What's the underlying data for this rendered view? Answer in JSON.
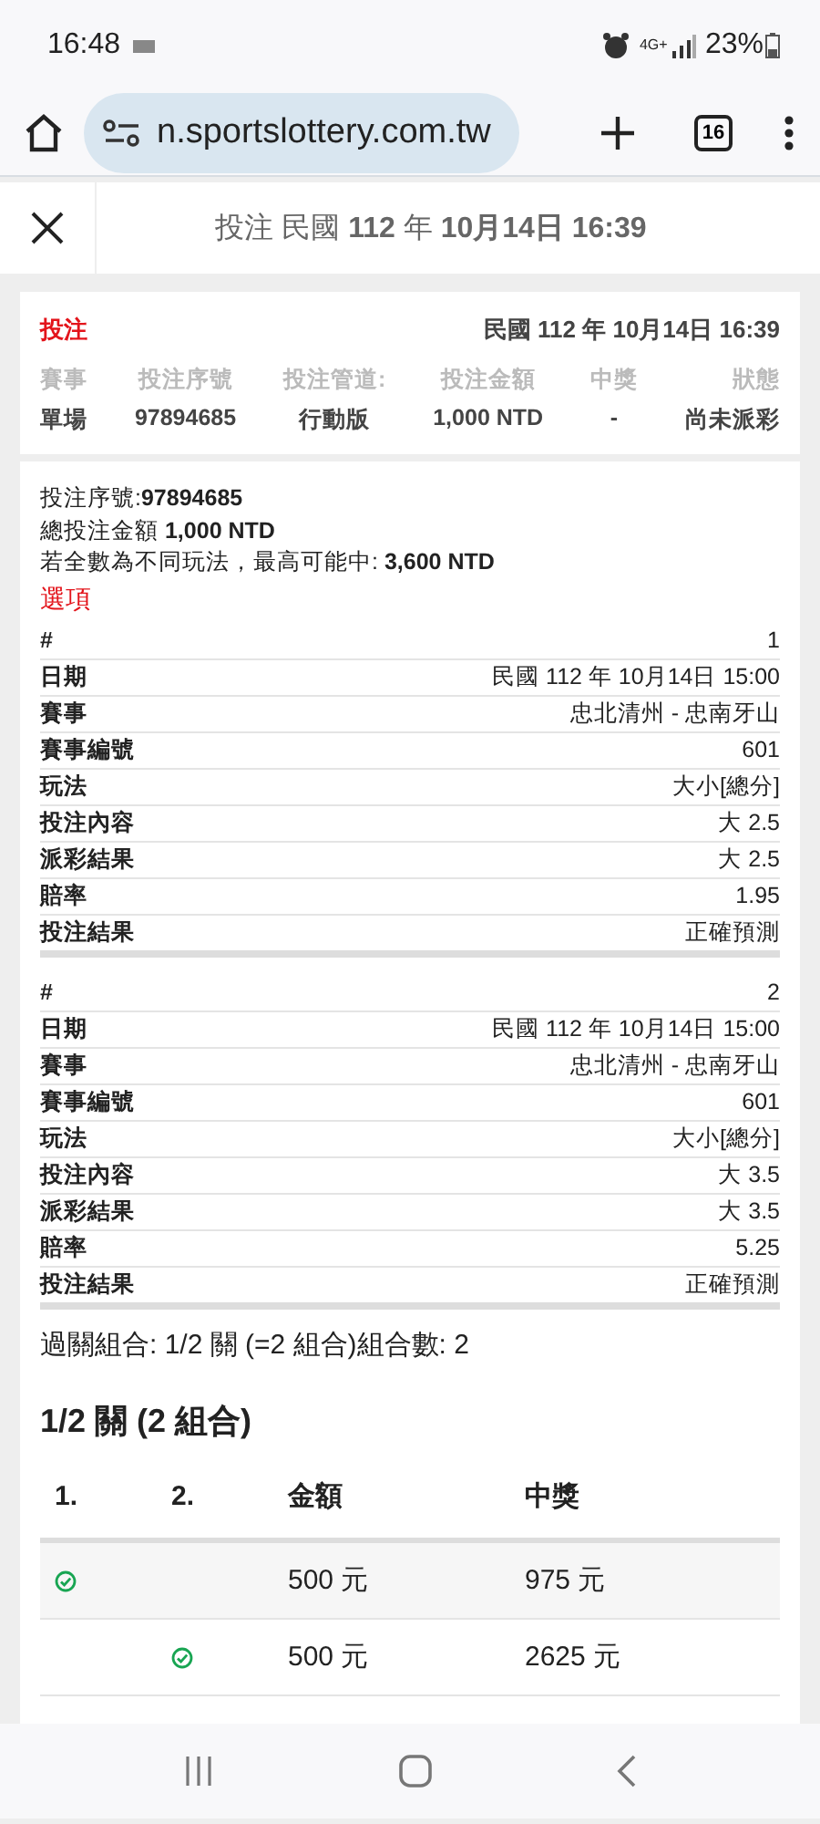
{
  "status_bar": {
    "time": "16:48",
    "network": "4G+",
    "battery": "23%"
  },
  "browser": {
    "url": "n.sportslottery.com.tw",
    "tab_count": "16"
  },
  "header": {
    "title": "投注 民國 **112** 年 **10月14日 16:39**"
  },
  "summary": {
    "type": "投注",
    "date": "民國 112 年 10月14日 16:39",
    "columns": [
      {
        "label": "賽事",
        "value": "單場"
      },
      {
        "label": "投注序號",
        "value": "97894685"
      },
      {
        "label": "投注管道:",
        "value": "行動版"
      },
      {
        "label": "投注金額",
        "value": "1,000 NTD"
      },
      {
        "label": "中獎",
        "value": "-"
      },
      {
        "label": "狀態",
        "value": "尚未派彩"
      }
    ]
  },
  "detail": {
    "lines": [
      "投注序號:**97894685**",
      "總投注金額 **1,000 NTD**",
      "若全數為不同玩法，最高可能中: **3,600 NTD**"
    ],
    "selections_title": "選項",
    "selections": [
      {
        "rows": [
          {
            "label": "#",
            "value": "1"
          },
          {
            "label": "日期",
            "value": "民國 112 年 10月14日 15:00"
          },
          {
            "label": "賽事",
            "value": "忠北清州 - 忠南牙山"
          },
          {
            "label": "賽事編號",
            "value": "601"
          },
          {
            "label": "玩法",
            "value": "大小[總分]"
          },
          {
            "label": "投注內容",
            "value": "大 2.5"
          },
          {
            "label": "派彩結果",
            "value": "大 2.5"
          },
          {
            "label": "賠率",
            "value": "1.95"
          },
          {
            "label": "投注結果",
            "value": "正確預測"
          }
        ]
      },
      {
        "rows": [
          {
            "label": "#",
            "value": "2"
          },
          {
            "label": "日期",
            "value": "民國 112 年 10月14日 15:00"
          },
          {
            "label": "賽事",
            "value": "忠北清州 - 忠南牙山"
          },
          {
            "label": "賽事編號",
            "value": "601"
          },
          {
            "label": "玩法",
            "value": "大小[總分]"
          },
          {
            "label": "投注內容",
            "value": "大 3.5"
          },
          {
            "label": "派彩結果",
            "value": "大 3.5"
          },
          {
            "label": "賠率",
            "value": "5.25"
          },
          {
            "label": "投注結果",
            "value": "正確預測"
          }
        ]
      }
    ],
    "combination": "過關組合: 1/2 關 (=2 組合)組合數: 2",
    "combo_title": "1/2 關 (2 組合)",
    "table": {
      "columns": [
        "1.",
        "2.",
        "金額",
        "中獎"
      ],
      "rows": [
        {
          "legs": [
            {
              "checked": true
            },
            {
              "checked": false
            }
          ],
          "amount": "500 元",
          "prize": "975 元"
        },
        {
          "legs": [
            {
              "checked": false
            },
            {
              "checked": true
            }
          ],
          "amount": "500 元",
          "prize": "2625 元"
        }
      ]
    }
  }
}
